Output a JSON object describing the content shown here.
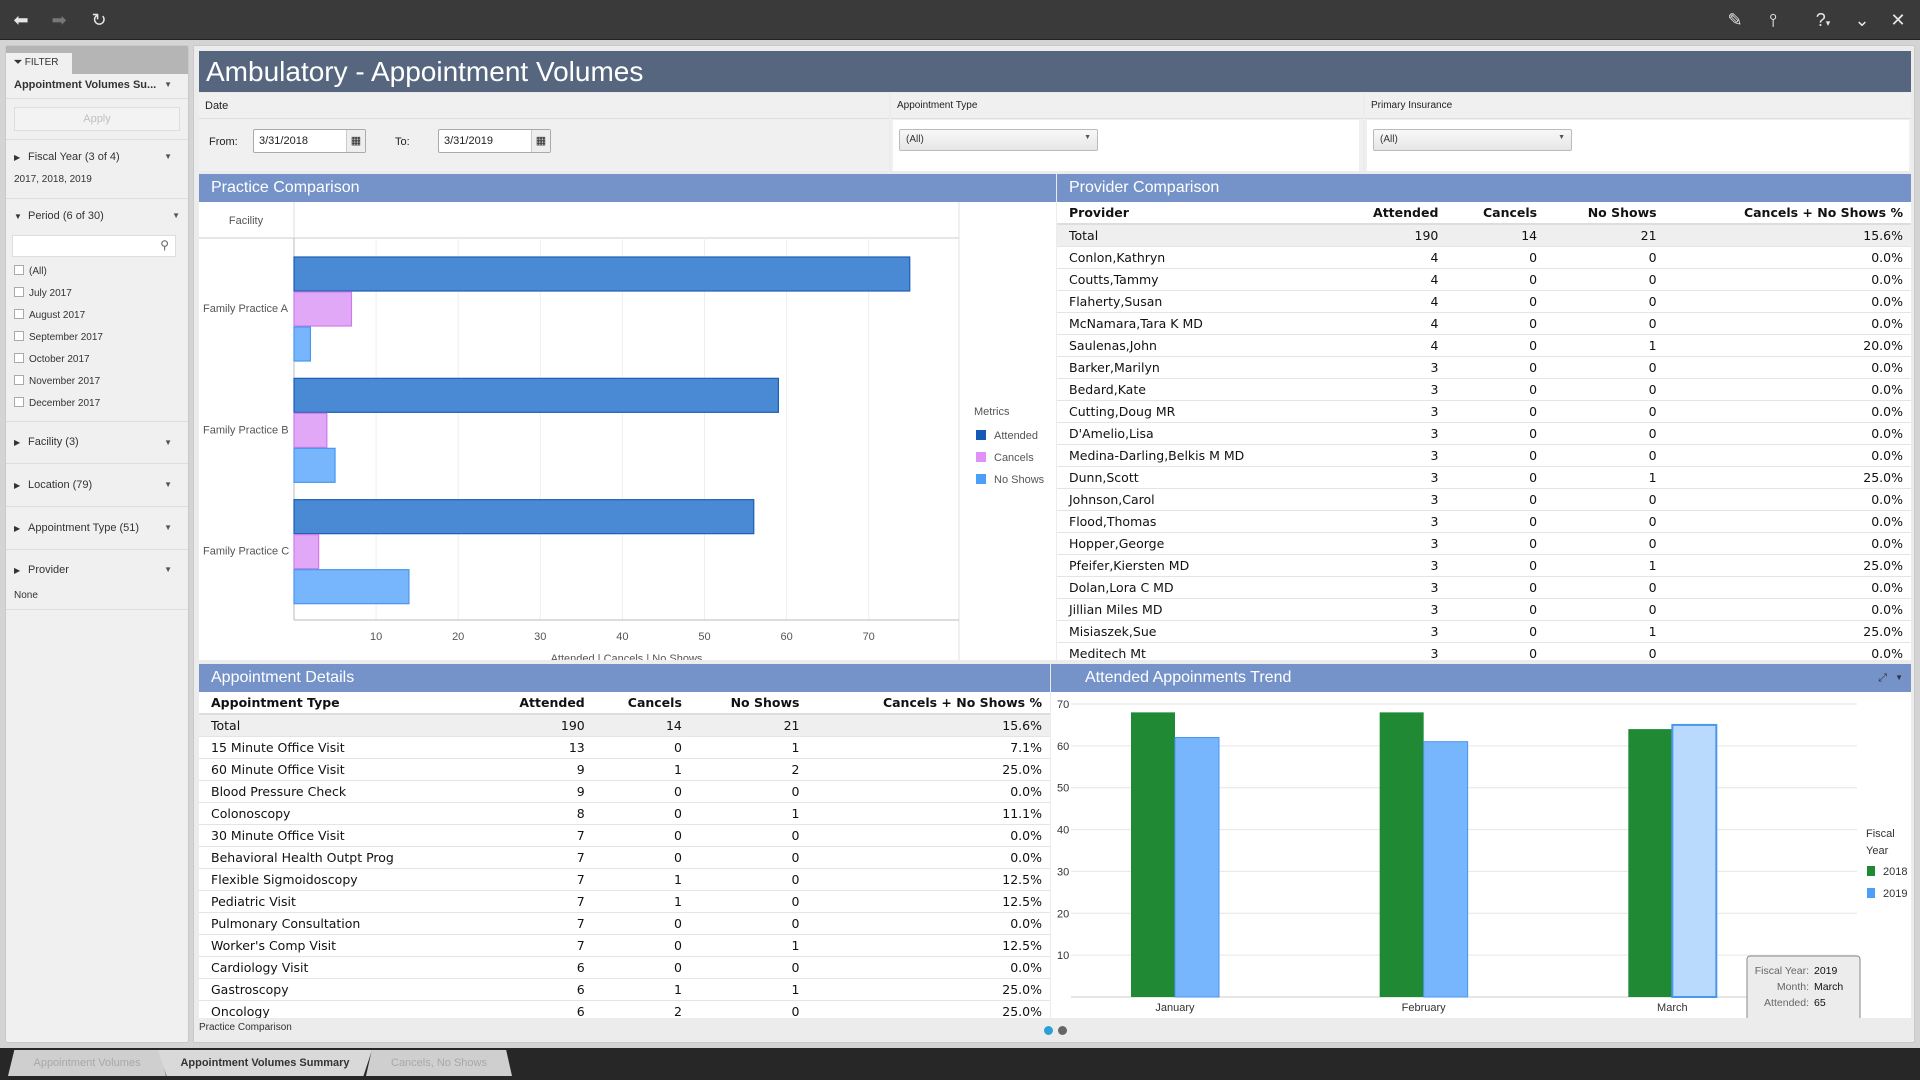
{
  "toolbar": {
    "left_icons": [
      "back-arrow-icon",
      "forward-arrow-icon",
      "refresh-icon"
    ],
    "right_icons": [
      "edit-pencil-icon",
      "share-icon",
      "help-icon",
      "collapse-chevron-icon",
      "close-icon"
    ]
  },
  "sidebar": {
    "tab_label": "FILTER",
    "report_select": "Appointment Volumes Su...",
    "apply_label": "Apply",
    "fiscal_year": {
      "label": "Fiscal Year (3 of 4)",
      "value": "2017, 2018, 2019"
    },
    "period": {
      "label": "Period (6 of 30)",
      "search_placeholder": "",
      "items": [
        "(All)",
        "July 2017",
        "August 2017",
        "September 2017",
        "October 2017",
        "November 2017",
        "December 2017"
      ]
    },
    "facility": {
      "label": "Facility (3)"
    },
    "location": {
      "label": "Location (79)"
    },
    "appointment_type": {
      "label": "Appointment Type (51)"
    },
    "provider": {
      "label": "Provider",
      "value": "None"
    }
  },
  "header": {
    "title": "Ambulatory - Appointment Volumes"
  },
  "filters": {
    "date": {
      "label": "Date",
      "from_label": "From:",
      "from_value": "3/31/2018",
      "to_label": "To:",
      "to_value": "3/31/2019"
    },
    "appointment_type": {
      "label": "Appointment Type",
      "value": "(All)"
    },
    "primary_insurance": {
      "label": "Primary Insurance",
      "value": "(All)"
    }
  },
  "practice_comparison": {
    "title": "Practice Comparison",
    "facility_header": "Facility"
  },
  "chart_data": [
    {
      "type": "bar",
      "orientation": "horizontal",
      "title": "Practice Comparison",
      "categories": [
        "Family Practice A",
        "Family Practice B",
        "Family Practice C"
      ],
      "series": [
        {
          "name": "Attended",
          "color": "#4a8ad4",
          "values": [
            75,
            59,
            56
          ]
        },
        {
          "name": "Cancels",
          "color": "#e2a8f8",
          "values": [
            7,
            4,
            3
          ]
        },
        {
          "name": "No Shows",
          "color": "#77b6fc",
          "values": [
            2,
            5,
            14
          ]
        }
      ],
      "xlabel": "Attended | Cancels | No Shows",
      "ylabel": "Facility",
      "xticks": [
        10,
        20,
        30,
        40,
        50,
        60,
        70
      ],
      "xlim": [
        0,
        81
      ],
      "legend": {
        "title": "Metrics",
        "position": "right"
      },
      "grid": true
    },
    {
      "type": "bar",
      "title": "Attended Appoinments Trend",
      "categories": [
        "January",
        "February",
        "March"
      ],
      "series": [
        {
          "name": "2018",
          "color": "#1f8a33",
          "values": [
            68,
            68,
            64
          ]
        },
        {
          "name": "2019",
          "color": "#77b6fc",
          "values": [
            62,
            61,
            65
          ]
        }
      ],
      "yticks": [
        10,
        20,
        30,
        40,
        50,
        60,
        70
      ],
      "ylim": [
        0,
        70
      ],
      "legend": {
        "title": "Fiscal Year",
        "position": "right"
      },
      "grid": true,
      "tooltip": {
        "rows": [
          [
            "Fiscal Year:",
            "2019"
          ],
          [
            "Month:",
            "March"
          ],
          [
            "Attended:",
            "65"
          ]
        ]
      }
    }
  ],
  "provider_comparison": {
    "title": "Provider Comparison",
    "columns": [
      "Provider",
      "Attended",
      "Cancels",
      "No Shows",
      "Cancels + No Shows %"
    ],
    "rows": [
      [
        "Total",
        "190",
        "14",
        "21",
        "15.6%"
      ],
      [
        "Conlon,Kathryn",
        "4",
        "0",
        "0",
        "0.0%"
      ],
      [
        "Coutts,Tammy",
        "4",
        "0",
        "0",
        "0.0%"
      ],
      [
        "Flaherty,Susan",
        "4",
        "0",
        "0",
        "0.0%"
      ],
      [
        "McNamara,Tara K MD",
        "4",
        "0",
        "0",
        "0.0%"
      ],
      [
        "Saulenas,John",
        "4",
        "0",
        "1",
        "20.0%"
      ],
      [
        "Barker,Marilyn",
        "3",
        "0",
        "0",
        "0.0%"
      ],
      [
        "Bedard,Kate",
        "3",
        "0",
        "0",
        "0.0%"
      ],
      [
        "Cutting,Doug MR",
        "3",
        "0",
        "0",
        "0.0%"
      ],
      [
        "D'Amelio,Lisa",
        "3",
        "0",
        "0",
        "0.0%"
      ],
      [
        "Medina-Darling,Belkis M MD",
        "3",
        "0",
        "0",
        "0.0%"
      ],
      [
        "Dunn,Scott",
        "3",
        "0",
        "1",
        "25.0%"
      ],
      [
        "Johnson,Carol",
        "3",
        "0",
        "0",
        "0.0%"
      ],
      [
        "Flood,Thomas",
        "3",
        "0",
        "0",
        "0.0%"
      ],
      [
        "Hopper,George",
        "3",
        "0",
        "0",
        "0.0%"
      ],
      [
        "Pfeifer,Kiersten MD",
        "3",
        "0",
        "1",
        "25.0%"
      ],
      [
        "Dolan,Lora C MD",
        "3",
        "0",
        "0",
        "0.0%"
      ],
      [
        "Jillian Miles MD",
        "3",
        "0",
        "0",
        "0.0%"
      ],
      [
        "Misiaszek,Sue",
        "3",
        "0",
        "1",
        "25.0%"
      ],
      [
        "Meditech Mt",
        "3",
        "0",
        "0",
        "0.0%"
      ]
    ]
  },
  "appointment_details": {
    "title": "Appointment Details",
    "columns": [
      "Appointment Type",
      "Attended",
      "Cancels",
      "No Shows",
      "Cancels + No Shows %"
    ],
    "rows": [
      [
        "Total",
        "190",
        "14",
        "21",
        "15.6%"
      ],
      [
        "15 Minute Office Visit",
        "13",
        "0",
        "1",
        "7.1%"
      ],
      [
        "60 Minute Office Visit",
        "9",
        "1",
        "2",
        "25.0%"
      ],
      [
        "Blood Pressure Check",
        "9",
        "0",
        "0",
        "0.0%"
      ],
      [
        "Colonoscopy",
        "8",
        "0",
        "1",
        "11.1%"
      ],
      [
        "30 Minute Office Visit",
        "7",
        "0",
        "0",
        "0.0%"
      ],
      [
        "Behavioral Health Outpt Prog",
        "7",
        "0",
        "0",
        "0.0%"
      ],
      [
        "Flexible Sigmoidoscopy",
        "7",
        "1",
        "0",
        "12.5%"
      ],
      [
        "Pediatric Visit",
        "7",
        "1",
        "0",
        "12.5%"
      ],
      [
        "Pulmonary Consultation",
        "7",
        "0",
        "0",
        "0.0%"
      ],
      [
        "Worker's Comp Visit",
        "7",
        "0",
        "1",
        "12.5%"
      ],
      [
        "Cardiology Visit",
        "6",
        "0",
        "0",
        "0.0%"
      ],
      [
        "Gastroscopy",
        "6",
        "1",
        "1",
        "25.0%"
      ],
      [
        "Oncology",
        "6",
        "2",
        "0",
        "25.0%"
      ]
    ]
  },
  "trend": {
    "title": "Attended Appoinments Trend"
  },
  "footer": {
    "label": "Practice Comparison",
    "pager_pages": 2,
    "pager_active": 1
  },
  "bottom_tabs": [
    {
      "label": "Appointment Volumes",
      "active": false
    },
    {
      "label": "Appointment Volumes Summary",
      "active": true
    },
    {
      "label": "Cancels, No Shows",
      "active": false
    }
  ]
}
